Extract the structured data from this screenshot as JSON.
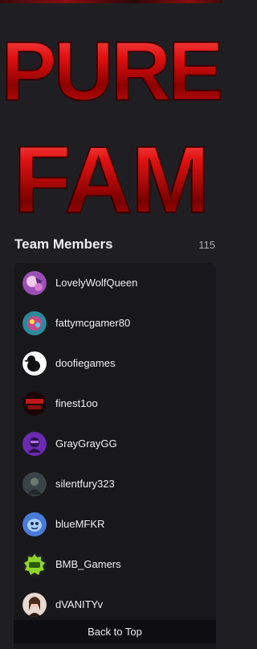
{
  "logo": {
    "line1": "PURE",
    "line2": "FAM",
    "color": "#d10f0f"
  },
  "team": {
    "title": "Team Members",
    "count": "115",
    "members": [
      {
        "name": "LovelyWolfQueen"
      },
      {
        "name": "fattymcgamer80"
      },
      {
        "name": "doofiegames"
      },
      {
        "name": "finest1oo"
      },
      {
        "name": "GrayGrayGG"
      },
      {
        "name": "silentfury323"
      },
      {
        "name": "blueMFKR"
      },
      {
        "name": "BMB_Gamers"
      },
      {
        "name": "dVANITYv"
      }
    ]
  },
  "back_to_top": "Back to Top"
}
